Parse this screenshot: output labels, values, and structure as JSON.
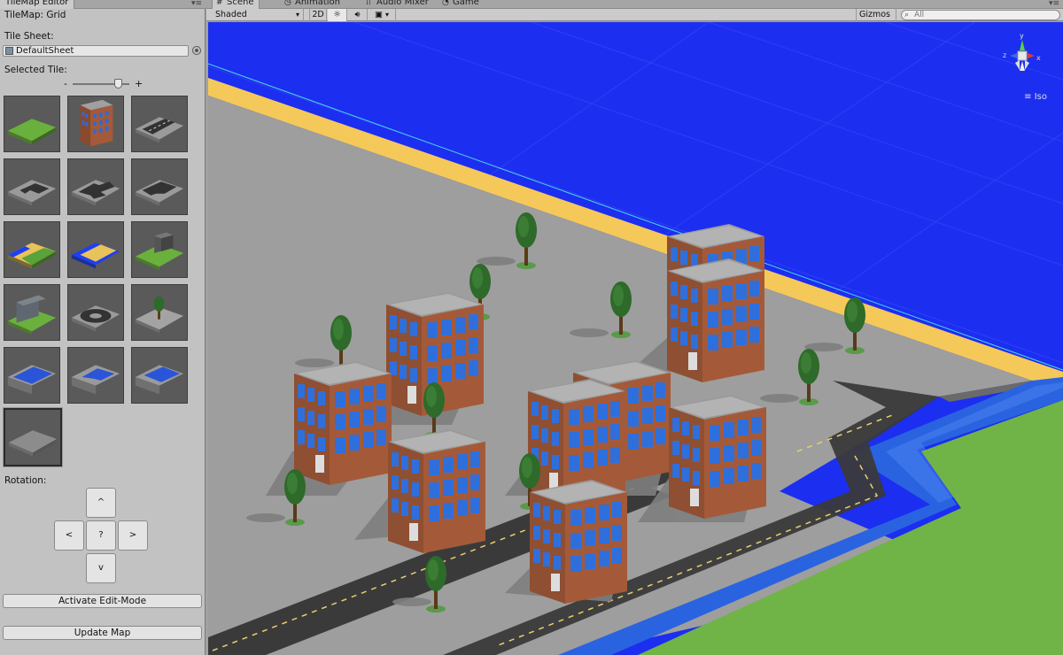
{
  "left_panel": {
    "tab_title": "TileMap Editor",
    "map_title": "TileMap: Grid",
    "tile_sheet_label": "Tile Sheet:",
    "tile_sheet_value": "DefaultSheet",
    "selected_tile_label": "Selected Tile:",
    "zoom_minus": "-",
    "zoom_plus": "+",
    "zoom_level": 0.8,
    "tiles": [
      {
        "name": "grass"
      },
      {
        "name": "building"
      },
      {
        "name": "road-straight"
      },
      {
        "name": "road-corner"
      },
      {
        "name": "road-cross"
      },
      {
        "name": "road-t-junction"
      },
      {
        "name": "beach-grass"
      },
      {
        "name": "beach-water"
      },
      {
        "name": "grass-box"
      },
      {
        "name": "wall-grass"
      },
      {
        "name": "roundabout"
      },
      {
        "name": "tree"
      },
      {
        "name": "water-channel"
      },
      {
        "name": "water-corner"
      },
      {
        "name": "water-end"
      },
      {
        "name": "plain-ground"
      }
    ],
    "selected_tile_index": 15,
    "rotation_label": "Rotation:",
    "rotation_buttons": {
      "up": "^",
      "left": "<",
      "center": "?",
      "right": ">",
      "down": "v"
    },
    "activate_button": "Activate Edit-Mode",
    "update_button": "Update Map"
  },
  "scene_tabs": [
    {
      "label": "Scene",
      "icon": "grid-icon",
      "active": true
    },
    {
      "label": "Animation",
      "icon": "clock-icon",
      "active": false
    },
    {
      "label": "Audio Mixer",
      "icon": "mixer-icon",
      "active": false
    },
    {
      "label": "Game",
      "icon": "pacman-icon",
      "active": false
    }
  ],
  "scene_toolbar": {
    "shading_mode": "Shaded",
    "mode_2d": "2D",
    "gizmos_label": "Gizmos",
    "search_placeholder": "All"
  },
  "gizmo": {
    "axis_y": "y",
    "axis_x": "x",
    "axis_z": "z",
    "projection": "Iso"
  },
  "colors": {
    "water": "#1c2ef0",
    "sand": "#f5c85a",
    "ground": "#9e9e9e",
    "grass": "#70b447",
    "road": "#3a3a3a",
    "river": "#2a63e0",
    "brick": "#8e4f33",
    "window": "#2f6fdc"
  }
}
